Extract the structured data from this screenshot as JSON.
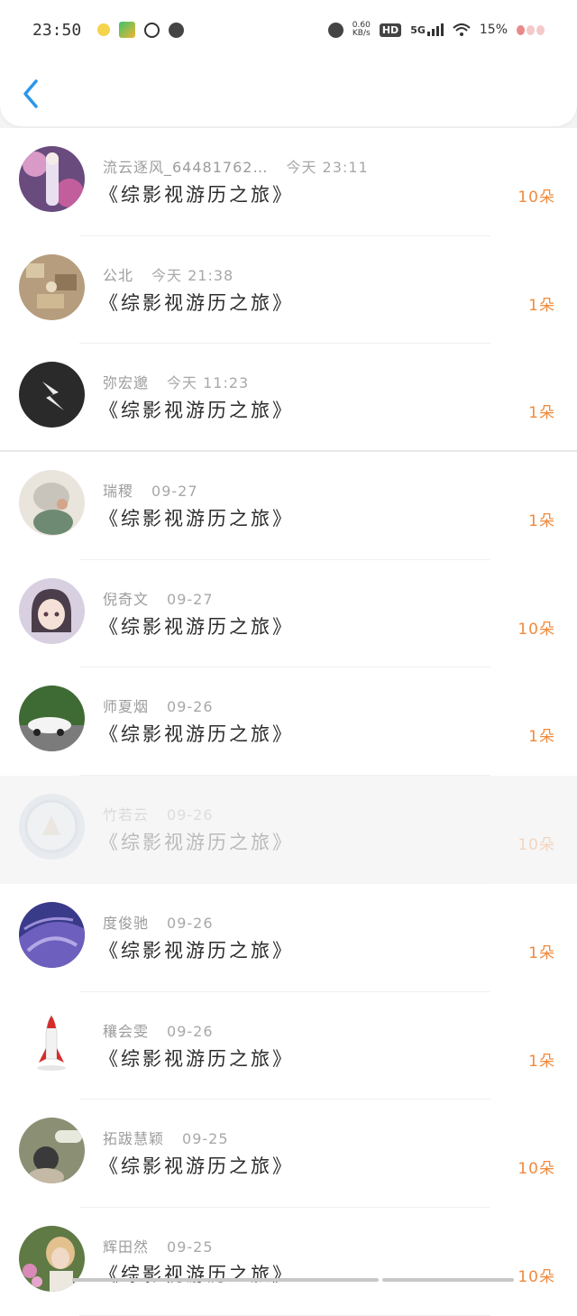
{
  "status_bar": {
    "time": "23:50",
    "net_speed_value": "0.60",
    "net_speed_unit": "KB/s",
    "hd": "HD",
    "network": "5G",
    "battery": "15%"
  },
  "header": {
    "back_icon": "chevron-left-icon",
    "accent_color": "#2a97ea"
  },
  "gifts": [
    {
      "name": "流云逐风_64481762…",
      "time": "今天 23:11",
      "work": "《综影视游历之旅》",
      "amount": "10朵"
    },
    {
      "name": "公北",
      "time": "今天 21:38",
      "work": "《综影视游历之旅》",
      "amount": "1朵"
    },
    {
      "name": "弥宏邈",
      "time": "今天 11:23",
      "work": "《综影视游历之旅》",
      "amount": "1朵"
    },
    {
      "name": "瑞稷",
      "time": "09-27",
      "work": "《综影视游历之旅》",
      "amount": "1朵"
    },
    {
      "name": "倪奇文",
      "time": "09-27",
      "work": "《综影视游历之旅》",
      "amount": "10朵"
    },
    {
      "name": "师夏烟",
      "time": "09-26",
      "work": "《综影视游历之旅》",
      "amount": "1朵"
    },
    {
      "name": "竹若云",
      "time": "09-26",
      "work": "《综影视游历之旅》",
      "amount": "10朵"
    },
    {
      "name": "度俊驰",
      "time": "09-26",
      "work": "《综影视游历之旅》",
      "amount": "1朵"
    },
    {
      "name": "穰会雯",
      "time": "09-26",
      "work": "《综影视游历之旅》",
      "amount": "1朵"
    },
    {
      "name": "拓跋慧颖",
      "time": "09-25",
      "work": "《综影视游历之旅》",
      "amount": "10朵"
    },
    {
      "name": "辉田然",
      "time": "09-25",
      "work": "《综影视游历之旅》",
      "amount": "10朵"
    }
  ],
  "colors": {
    "amount": "#f08a3c",
    "title": "#2b2b2b",
    "meta": "#9c9c9c"
  }
}
